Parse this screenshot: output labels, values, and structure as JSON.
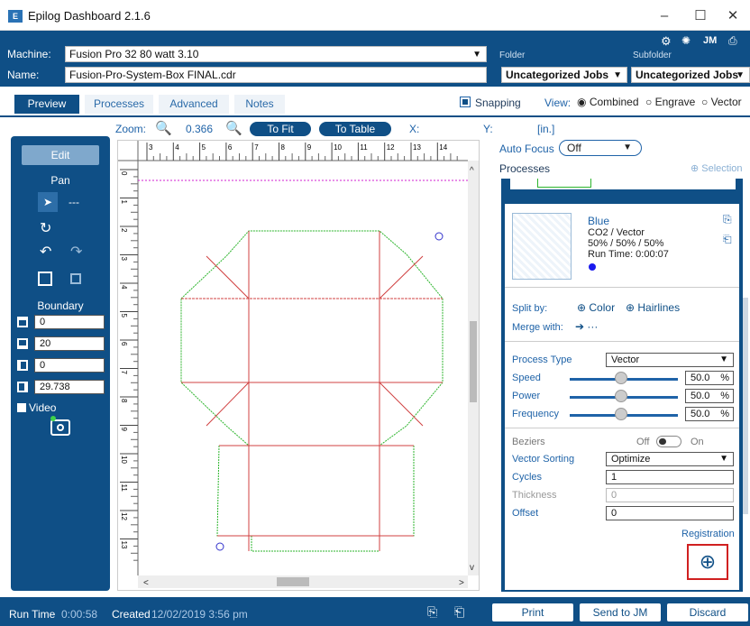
{
  "window": {
    "title": "Epilog Dashboard 2.1.6",
    "minimize": "–",
    "maximize": "☐",
    "close": "✕"
  },
  "header": {
    "machine_label": "Machine:",
    "machine_value": "Fusion Pro 32 80 watt 3.10",
    "name_label": "Name:",
    "name_value": "Fusion-Pro-System-Box FINAL.cdr",
    "folder_label": "Folder",
    "folder_value": "Uncategorized Jobs",
    "subfolder_label": "Subfolder",
    "subfolder_value": "Uncategorized Jobs",
    "jm_label": "JM"
  },
  "tabs": [
    "Preview",
    "Processes",
    "Advanced",
    "Notes"
  ],
  "view": {
    "snapping": "Snapping",
    "view_label": "View:",
    "combined": "Combined",
    "engrave": "Engrave",
    "vector": "Vector"
  },
  "zoom": {
    "label": "Zoom:",
    "value": "0.366",
    "to_fit": "To Fit",
    "to_table": "To Table",
    "x_label": "X:",
    "y_label": "Y:",
    "units": "[in.]"
  },
  "left": {
    "edit": "Edit",
    "pan": "Pan",
    "dashes": "---",
    "boundary": "Boundary",
    "b1": "0",
    "b2": "20",
    "b3": "0",
    "b4": "29.738",
    "video": "Video"
  },
  "ruler": {
    "h": [
      "3",
      "4",
      "5",
      "6",
      "7",
      "8",
      "9",
      "10",
      "11",
      "12",
      "13",
      "14"
    ],
    "v": [
      "0",
      "1",
      "2",
      "3",
      "4",
      "5",
      "6",
      "7",
      "8",
      "9",
      "10",
      "11",
      "12",
      "13"
    ]
  },
  "right": {
    "autofocus_label": "Auto Focus",
    "autofocus_value": "Off",
    "processes": "Processes",
    "selection": "Selection",
    "process_name": "Blue",
    "process_type_line": "CO2 / Vector",
    "process_settings": "50% / 50% / 50%",
    "run_time": "Run Time: 0:00:07",
    "split_by": "Split by:",
    "color": "Color",
    "hairlines": "Hairlines",
    "merge_with": "Merge with:",
    "merge_dots": "···",
    "process_type_label": "Process Type",
    "process_type_value": "Vector",
    "speed": "Speed",
    "speed_value": "50.0",
    "power": "Power",
    "power_value": "50.0",
    "frequency": "Frequency",
    "frequency_value": "50.0",
    "pct": "%",
    "beziers": "Beziers",
    "off": "Off",
    "on": "On",
    "vector_sorting": "Vector Sorting",
    "vector_sorting_value": "Optimize",
    "cycles": "Cycles",
    "cycles_value": "1",
    "thickness": "Thickness",
    "thickness_value": "0",
    "offset": "Offset",
    "offset_value": "0",
    "registration": "Registration"
  },
  "footer": {
    "run_time_label": "Run Time",
    "run_time": "0:00:58",
    "created_label": "Created",
    "created": "12/02/2019 3:56 pm",
    "print": "Print",
    "send": "Send to JM",
    "discard": "Discard"
  },
  "colors": {
    "brand": "#0f4f86",
    "link": "#1f63a8"
  }
}
